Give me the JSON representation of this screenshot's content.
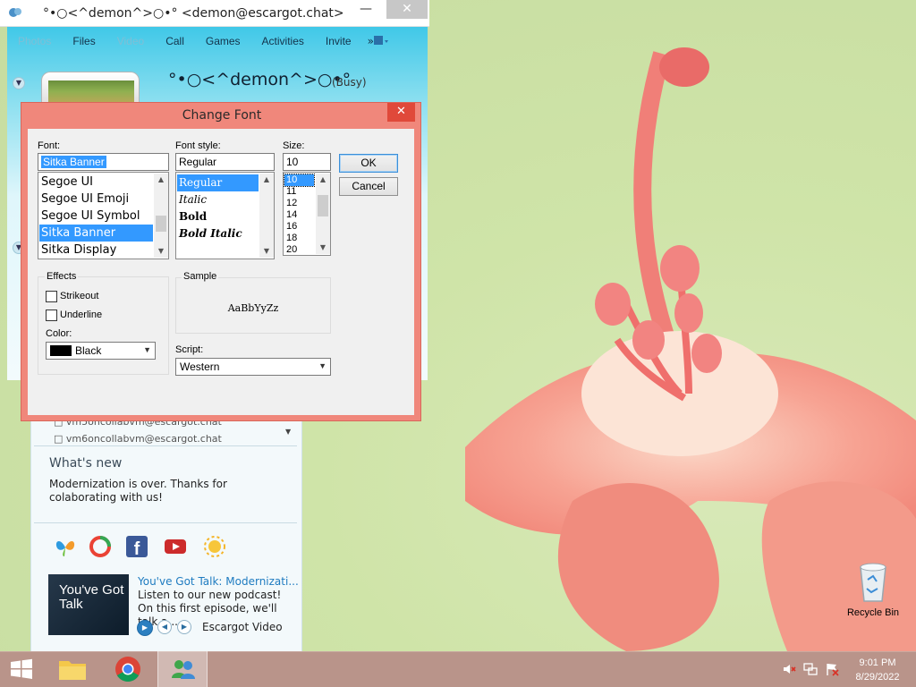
{
  "messenger": {
    "title": "°•○<^demon^>○•° <demon@escargot.chat>",
    "tabs": [
      "Photos",
      "Files",
      "Video",
      "Call",
      "Games",
      "Activities",
      "Invite"
    ],
    "tabs_more": "»",
    "display_name": "°•○<^demon^>○•°",
    "status": "(Busy)",
    "contacts": [
      "vm5oncollabvm@escargot.chat",
      "vm6oncollabvm@escargot.chat"
    ],
    "whats_new_title": "What's new",
    "whats_new_text": "Modernization is over. Thanks for colaborating with us!",
    "promo_thumb_text": "You've Got Talk",
    "promo_title": "You've Got Talk: Modernizati...",
    "promo_text": "Listen to our new podcast! On this first episode, we'll talk a...",
    "promo_source": "Escargot Video"
  },
  "dialog": {
    "title": "Change Font",
    "font_label": "Font:",
    "font_value": "Sitka Banner",
    "font_list": [
      "Segoe UI",
      "Segoe UI Emoji",
      "Segoe UI Symbol",
      "Sitka Banner",
      "Sitka Display"
    ],
    "style_label": "Font style:",
    "style_value": "Regular",
    "style_list": [
      "Regular",
      "Italic",
      "Bold",
      "Bold Italic"
    ],
    "size_label": "Size:",
    "size_value": "10",
    "size_list": [
      "10",
      "11",
      "12",
      "14",
      "16",
      "18",
      "20"
    ],
    "ok": "OK",
    "cancel": "Cancel",
    "effects_label": "Effects",
    "strikeout": "Strikeout",
    "underline": "Underline",
    "color_label": "Color:",
    "color_value": "Black",
    "sample_label": "Sample",
    "sample_text": "AaBbYyZz",
    "script_label": "Script:",
    "script_value": "Western"
  },
  "desktop": {
    "recycle_bin": "Recycle Bin"
  },
  "taskbar": {
    "time": "9:01 PM",
    "date": "8/29/2022"
  },
  "colors": {
    "dialog_frame": "#f0877b",
    "selection": "#3399ff",
    "taskbar": "#b9948a",
    "messenger_header": "#40c8e8"
  }
}
